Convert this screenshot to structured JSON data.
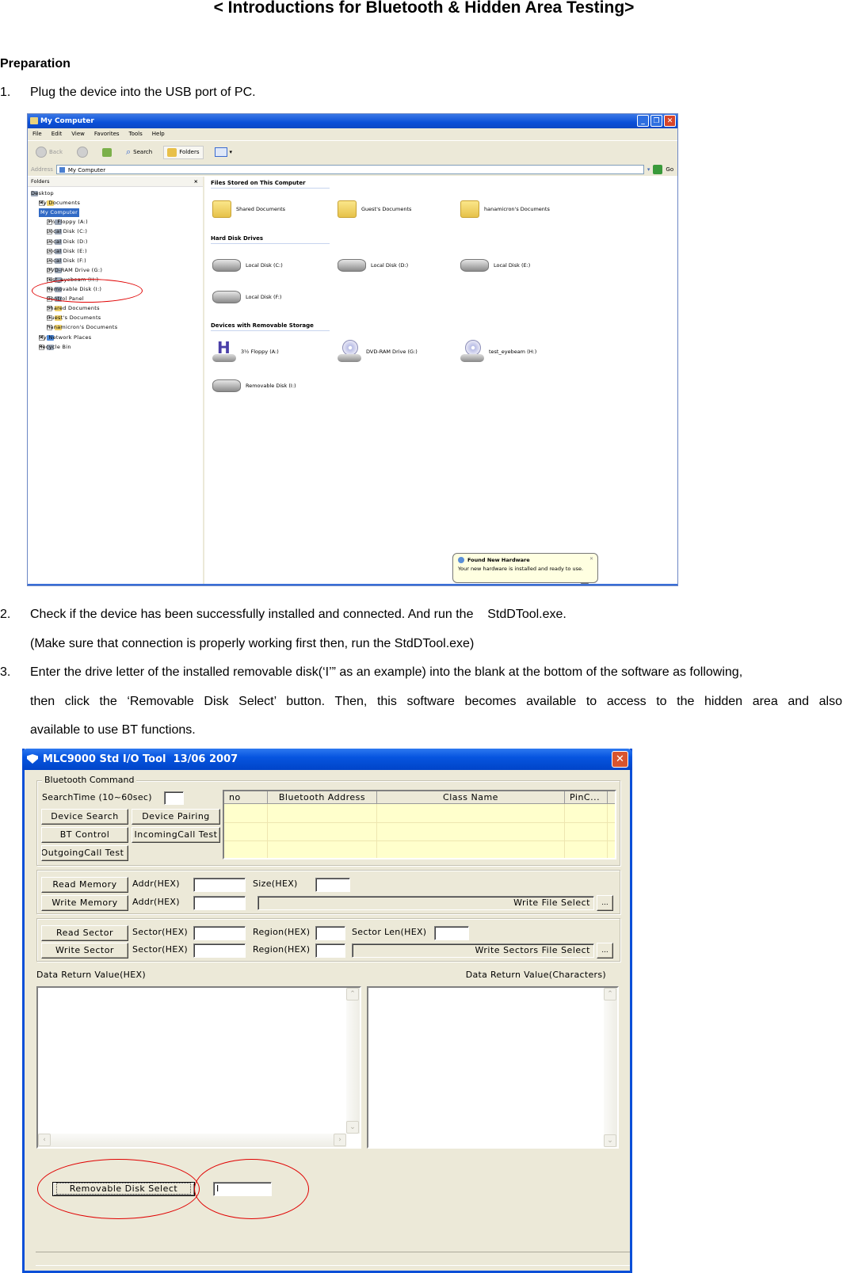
{
  "document": {
    "title": "< Introductions for Bluetooth & Hidden Area Testing>",
    "section_heading": "Preparation",
    "steps": [
      {
        "num": "1.",
        "lines": [
          "Plug the device into the USB port of PC."
        ]
      },
      {
        "num": "2.",
        "lines": [
          "Check if the device has been successfully installed and connected. And run the    StdDTool.exe.",
          "(Make sure that connection is properly working first then, run the StdDTool.exe)"
        ]
      },
      {
        "num": "3.",
        "lines": [
          "Enter the drive letter of the installed removable disk(‘I’” as an example) into the blank at the bottom of the software as following,",
          "then click the ‘Removable Disk Select’ button. Then, this software becomes available to access to the hidden area and also",
          "available to use BT functions."
        ]
      }
    ]
  },
  "explorer": {
    "window_title": "My Computer",
    "menu": [
      "File",
      "Edit",
      "View",
      "Favorites",
      "Tools",
      "Help"
    ],
    "toolbar": {
      "back": "Back",
      "search": "Search",
      "folders": "Folders"
    },
    "address_label": "Address",
    "address_value": "My Computer",
    "go_label": "Go",
    "folders_pane": {
      "header": "Folders",
      "close": "×",
      "tree": [
        {
          "label": "Desktop",
          "level": 0,
          "icon": "desktop-icon"
        },
        {
          "label": "My Documents",
          "level": 1,
          "icon": "folder-icon"
        },
        {
          "label": "My Computer",
          "level": 1,
          "icon": "computer-icon",
          "selected": true
        },
        {
          "label": "3½ Floppy (A:)",
          "level": 2,
          "icon": "floppy-icon"
        },
        {
          "label": "Local Disk (C:)",
          "level": 2,
          "icon": "disk-icon"
        },
        {
          "label": "Local Disk (D:)",
          "level": 2,
          "icon": "disk-icon"
        },
        {
          "label": "Local Disk (E:)",
          "level": 2,
          "icon": "disk-icon"
        },
        {
          "label": "Local Disk (F:)",
          "level": 2,
          "icon": "disk-icon"
        },
        {
          "label": "DVD-RAM Drive (G:)",
          "level": 2,
          "icon": "cd-icon"
        },
        {
          "label": "test_eyebeam (H:)",
          "level": 2,
          "icon": "cd-icon"
        },
        {
          "label": "Removable Disk (I:)",
          "level": 2,
          "icon": "disk-icon"
        },
        {
          "label": "Control Panel",
          "level": 2,
          "icon": "control-panel-icon"
        },
        {
          "label": "Shared Documents",
          "level": 2,
          "icon": "folder-icon"
        },
        {
          "label": "Guest's Documents",
          "level": 2,
          "icon": "folder-icon"
        },
        {
          "label": "hanamicron's Documents",
          "level": 2,
          "icon": "folder-icon"
        },
        {
          "label": "My Network Places",
          "level": 1,
          "icon": "network-icon"
        },
        {
          "label": "Recycle Bin",
          "level": 1,
          "icon": "recycle-bin-icon"
        }
      ]
    },
    "groups": [
      {
        "title": "Files Stored on This Computer",
        "items": [
          "Shared Documents",
          "Guest's Documents",
          "hanamicron's Documents"
        ]
      },
      {
        "title": "Hard Disk Drives",
        "items": [
          "Local Disk (C:)",
          "Local Disk (D:)",
          "Local Disk (E:)",
          "Local Disk (F:)"
        ]
      },
      {
        "title": "Devices with Removable Storage",
        "items": [
          "3½ Floppy (A:)",
          "DVD-RAM Drive (G:)",
          "test_eyebeam (H:)",
          "Removable Disk (I:)"
        ]
      }
    ],
    "balloon": {
      "title": "Found New Hardware",
      "text": "Your new hardware is installed and ready to use."
    }
  },
  "tool": {
    "window_title": "MLC9000 Std I/O Tool  13/06 2007",
    "close_glyph": "✕",
    "bluetooth": {
      "group_label": "Bluetooth Command",
      "search_time_label": "SearchTime (10~60sec)",
      "search_time_value": "",
      "buttons": {
        "device_search": "Device Search",
        "device_pairing": "Device Pairing",
        "bt_control": "BT Control",
        "incoming_call": "IncomingCall Test",
        "outgoing_call": "OutgoingCall Test"
      },
      "table": {
        "columns": [
          "no",
          "Bluetooth Address",
          "Class Name",
          "PinC..."
        ],
        "rows": [
          [
            "",
            "",
            "",
            ""
          ],
          [
            "",
            "",
            "",
            ""
          ],
          [
            "",
            "",
            "",
            ""
          ]
        ]
      }
    },
    "memory": {
      "read_button": "Read Memory",
      "write_button": "Write Memory",
      "addr_label": "Addr(HEX)",
      "size_label": "Size(HEX)",
      "read_addr_value": "",
      "size_value": "",
      "write_addr_value": "",
      "write_file_label": "Write File Select",
      "browse": "..."
    },
    "sector": {
      "read_button": "Read Sector",
      "write_button": "Write Sector",
      "sector_label": "Sector(HEX)",
      "region_label": "Region(HEX)",
      "sector_len_label": "Sector Len(HEX)",
      "write_file_label": "Write Sectors File Select",
      "browse": "..."
    },
    "output": {
      "hex_label": "Data Return Value(HEX)",
      "chars_label": "Data Return Value(Characters)",
      "hex_value": "",
      "chars_value": ""
    },
    "removable_disk_button": "Removable Disk Select",
    "drive_letter_value": "I",
    "status_text": ""
  }
}
